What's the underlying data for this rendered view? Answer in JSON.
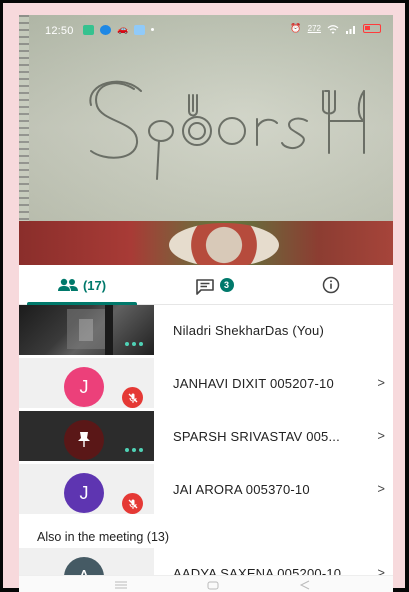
{
  "status_bar": {
    "time": "12:50",
    "network_speed": "272",
    "colors": {
      "text": "#ffffff",
      "battery": "#ff3b3b"
    }
  },
  "video": {
    "drawing_text": "SPARSH"
  },
  "tabs": {
    "people_count": "(17)",
    "chat_badge": "3"
  },
  "participants": [
    {
      "name": "Niladri ShekharDas (You)",
      "type": "video",
      "muted": false,
      "has_chevron": false
    },
    {
      "name": "JANHAVI DIXIT 005207-10",
      "initial": "J",
      "avatar_color": "#ec407a",
      "muted": true,
      "has_chevron": true
    },
    {
      "name": "SPARSH SRIVASTAV 005...",
      "type": "pinned",
      "muted": false,
      "has_chevron": true
    },
    {
      "name": "JAI ARORA 005370-10",
      "initial": "J",
      "avatar_color": "#5e35b1",
      "muted": true,
      "has_chevron": true
    }
  ],
  "also_in_meeting": {
    "label": "Also in the meeting (13)",
    "first": {
      "name": "AADYA SAXENA 005200-10",
      "initial": "A",
      "avatar_color": "#455a64"
    }
  },
  "nav_bar": {
    "items": [
      "menu",
      "home",
      "back"
    ]
  },
  "colors": {
    "accent": "#00796b",
    "mute_red": "#e53935",
    "speaking_dots": "#4fd1b5"
  }
}
